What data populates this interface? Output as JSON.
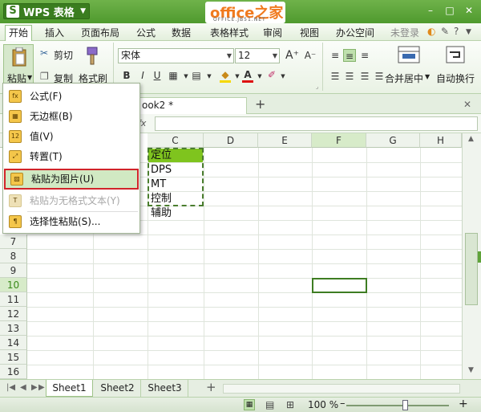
{
  "app": {
    "logo": "S",
    "name": "WPS 表格",
    "watermark": "office之家",
    "watermark_sub": "OFFICE.JB51.NET"
  },
  "window_controls": [
    "–",
    "□",
    "✕"
  ],
  "menubar": {
    "items": [
      "开始",
      "插入",
      "页面布局",
      "公式",
      "数据",
      "表格样式",
      "审阅",
      "视图",
      "办公空间"
    ],
    "login": "未登录"
  },
  "ribbon": {
    "paste": "粘贴",
    "cut": "剪切",
    "copy": "复制",
    "format_painter": "格式刷",
    "font_name": "宋体",
    "font_size": "12",
    "bold": "B",
    "italic": "I",
    "underline": "U",
    "merge_center": "合并居中",
    "wrap_text": "自动换行"
  },
  "workbook_tab": "ook2 *",
  "formula_bar": {
    "fx": "fx",
    "value": ""
  },
  "columns": [
    "C",
    "D",
    "E",
    "F",
    "G",
    "H"
  ],
  "selected_column": "F",
  "rows": [
    "7",
    "8",
    "9",
    "10",
    "11",
    "12",
    "13",
    "14",
    "15",
    "16"
  ],
  "selected_row": "10",
  "cells": {
    "c1": "定位",
    "c2": "DPS",
    "c3": "MT",
    "c4": "控制",
    "c5": "辅助"
  },
  "context_menu": [
    {
      "label": "公式(F)",
      "icon": "formula-paste-icon",
      "disabled": false
    },
    {
      "label": "无边框(B)",
      "icon": "no-border-paste-icon",
      "disabled": false
    },
    {
      "label": "值(V)",
      "icon": "values-paste-icon",
      "disabled": false
    },
    {
      "label": "转置(T)",
      "icon": "transpose-paste-icon",
      "disabled": false
    },
    {
      "label": "粘贴为图片(U)",
      "icon": "picture-paste-icon",
      "disabled": false,
      "highlighted": true
    },
    {
      "label": "粘贴为无格式文本(Y)",
      "icon": "plain-text-paste-icon",
      "disabled": true
    },
    {
      "label": "选择性粘贴(S)...",
      "icon": "paste-special-icon",
      "disabled": false
    }
  ],
  "sheets": [
    "Sheet1",
    "Sheet2",
    "Sheet3"
  ],
  "active_sheet": "Sheet1",
  "status": {
    "zoom": "100 %",
    "zoom_minus": "–",
    "zoom_plus": "+"
  },
  "colors": {
    "accent": "#4f9a2e",
    "highlight_cell": "#7fc41e",
    "menu_hover": "#d1e9c3",
    "callout_border": "#d1242a"
  }
}
